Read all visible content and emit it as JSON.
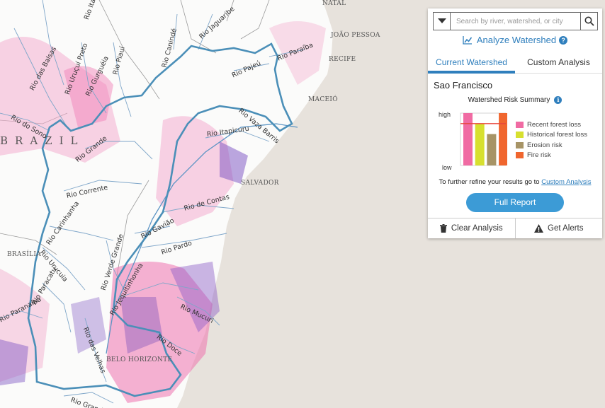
{
  "map": {
    "country": "BRAZIL",
    "cities": {
      "natal": "NATAL",
      "joao_pessoa": "JOÃO PESSOA",
      "recife": "RECIFE",
      "maceio": "MACEIÓ",
      "salvador": "SALVADOR",
      "brasilia": "BRASÍLIA",
      "belo_horizonte": "BELO HORIZONTE"
    },
    "rivers": {
      "itapicuru_top": "Rio Itapi",
      "das_balsas": "Rio das Balsas",
      "urucui_preto": "Rio Uruçuí Preto",
      "gurgueia": "Rio Gurguéia",
      "piaui": "Rio Piauí",
      "caninde": "Rio Canindé",
      "jaguaribe": "Rio Jaguaribe",
      "paraiba": "Rio Paraíba",
      "pajeu": "Rio Pajeú",
      "do_sono": "Rio do Sono",
      "grande": "Rio Grande",
      "vaza_barris": "Rio Vaza Barris",
      "itapicuru": "Rio Itapicuru",
      "corrente": "Rio Corrente",
      "de_contas": "Rio de Contas",
      "carinhanha": "Rio Carinhanha",
      "gaviao": "Rio Gavião",
      "urucuia": "Rio Urucuia",
      "pardo": "Rio Pardo",
      "verde_grande": "Rio Verde Grande",
      "jequitinhonha": "Rio Jequitinhonha",
      "paracatu": "Rio Paracatu",
      "mucuri": "Rio Mucuri",
      "paranaiba": "Rio Paranaíba",
      "das_velhas": "Rio das Velhas",
      "doce": "Rio Doce",
      "grande_south": "Rio Grande"
    }
  },
  "panel": {
    "search": {
      "placeholder": "Search by river, watershed, or city",
      "value": ""
    },
    "analyze_label": "Analyze Watershed",
    "help_glyph": "?",
    "tabs": [
      "Current Watershed",
      "Custom Analysis"
    ],
    "active_tab": 0,
    "watershed_name": "Sao Francisco",
    "risk_title": "Watershed Risk Summary",
    "info_glyph": "i",
    "axis_high": "high",
    "axis_low": "low",
    "refine_text": "To further refine your results go to ",
    "refine_link": "Custom Analysis",
    "full_report": "Full Report",
    "clear_analysis": "Clear Analysis",
    "get_alerts": "Get Alerts"
  },
  "chart_data": {
    "type": "bar",
    "title": "Watershed Risk Summary",
    "categories": [
      "Recent forest loss",
      "Historical forest loss",
      "Erosion risk",
      "Fire risk"
    ],
    "values": [
      1.0,
      0.8,
      0.6,
      1.0
    ],
    "colors": [
      "#f06ba3",
      "#d7e02f",
      "#a79466",
      "#f0662e"
    ],
    "threshold": 0.8,
    "threshold_color": "#e8463c",
    "ylim": [
      0,
      1
    ],
    "ylabels": [
      "low",
      "high"
    ],
    "legend_position": "right"
  }
}
